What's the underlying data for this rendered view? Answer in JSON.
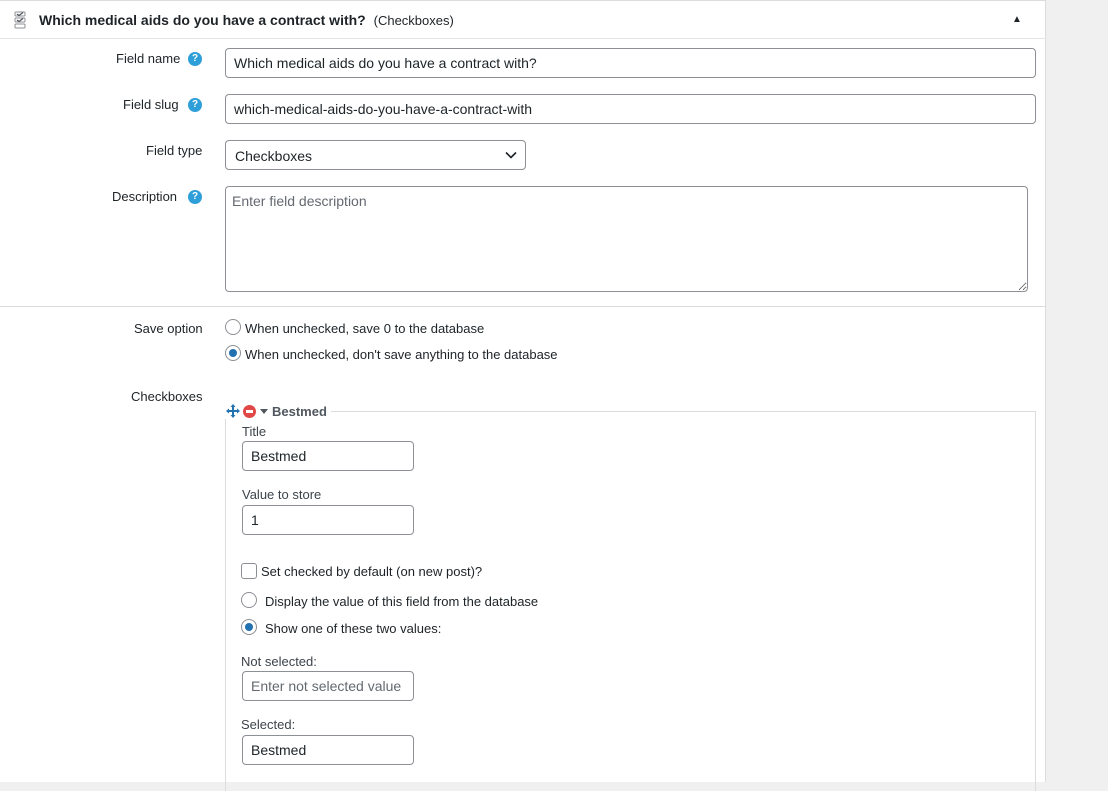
{
  "header": {
    "title": "Which medical aids do you have a contract with?",
    "type_label": "(Checkboxes)",
    "toggle_glyph": "▲"
  },
  "fields": {
    "field_name": {
      "label": "Field name",
      "value": "Which medical aids do you have a contract with?"
    },
    "field_slug": {
      "label": "Field slug",
      "value": "which-medical-aids-do-you-have-a-contract-with"
    },
    "field_type": {
      "label": "Field type",
      "value": "Checkboxes"
    },
    "description": {
      "label": "Description",
      "placeholder": "Enter field description"
    },
    "help_glyph": "?"
  },
  "save_option": {
    "label": "Save option",
    "options": [
      {
        "label": "When unchecked, save 0 to the database",
        "selected": false
      },
      {
        "label": "When unchecked, don't save anything to the database",
        "selected": true
      }
    ]
  },
  "checkboxes": {
    "label": "Checkboxes",
    "item": {
      "legend": "Bestmed",
      "title_label": "Title",
      "title_value": "Bestmed",
      "value_label": "Value to store",
      "value_value": "1",
      "default_checkbox_label": "Set checked by default (on new post)?",
      "default_checked": false,
      "display_options": [
        {
          "label": "Display the value of this field from the database",
          "selected": false
        },
        {
          "label": "Show one of these two values:",
          "selected": true
        }
      ],
      "not_selected_label": "Not selected:",
      "not_selected_placeholder": "Enter not selected value",
      "selected_label": "Selected:",
      "selected_value": "Bestmed"
    }
  },
  "colors": {
    "accent": "#2271b1",
    "help_icon": "#2e9fd8",
    "remove_icon": "#e04848"
  }
}
